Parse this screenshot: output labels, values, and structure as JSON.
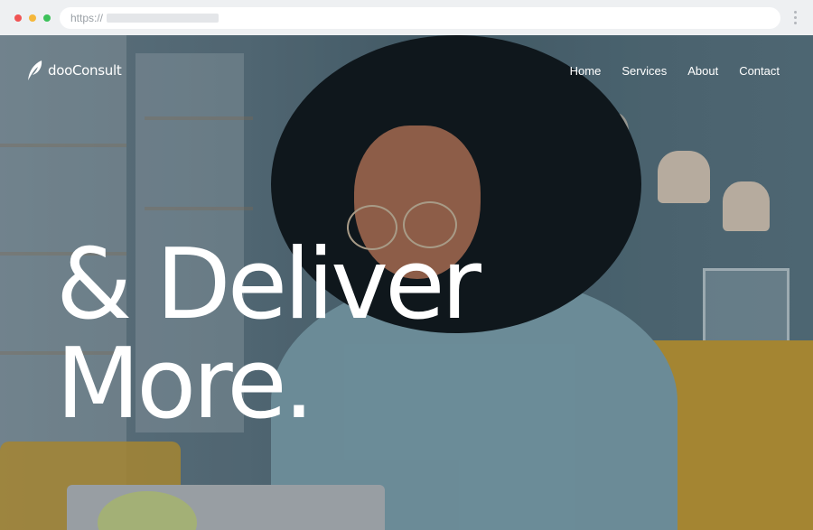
{
  "browser": {
    "url_scheme": "https://",
    "traffic_lights": [
      "close",
      "minimize",
      "maximize"
    ]
  },
  "site": {
    "brand": "dooConsult",
    "nav": [
      {
        "label": "Home"
      },
      {
        "label": "Services"
      },
      {
        "label": "About"
      },
      {
        "label": "Contact"
      }
    ],
    "hero": {
      "line1": "& Deliver",
      "line2": "More."
    }
  },
  "colors": {
    "text": "#ffffff",
    "chrome_bg": "#eef0f2",
    "hero_tint": "#4b6470",
    "sofa": "#c49a32",
    "sweater": "#7ea2ae"
  }
}
